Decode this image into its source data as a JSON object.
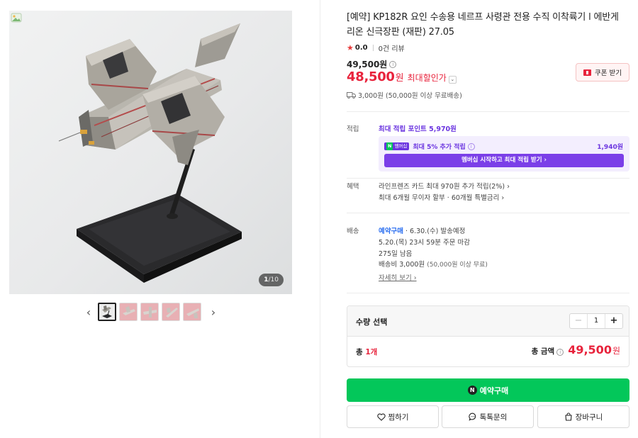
{
  "gallery": {
    "counter_current": "1",
    "counter_total": "/10",
    "prev_arrow": "‹",
    "next_arrow": "›",
    "thumbnail_count": 5,
    "icons": {
      "prev": "chevron-left-icon",
      "next": "chevron-right-icon",
      "badge": "image-badge-icon"
    }
  },
  "product": {
    "title": "[예약] KP182R 요인 수송용 네르프 사령관 전용 수직 이착륙기 l 에반게리온 신극장판 (재판) 27.05",
    "rating": "0.0",
    "review_count": "0건 리뷰",
    "original_price": "49,500원",
    "sale_price": "48,500",
    "sale_unit": "원",
    "sale_label": "최대할인가",
    "coupon_label": "쿠폰 받기",
    "shipping_summary": "3,000원 (50,000원 이상 무료배송)"
  },
  "points": {
    "label": "적립",
    "max_text": "최대 적립 포인트",
    "max_value": "5,970원",
    "member_badge": "멤버십",
    "member_extra": "최대 5% 추가 적립",
    "member_amount": "1,940원",
    "member_button": "멤버십 시작하고 최대 적립 받기 ›"
  },
  "benefits": {
    "label": "혜택",
    "line1": "라인프렌즈 카드 최대 970원 추가 적립(2%) ›",
    "line2": "최대 6개월 무이자 할부 · 60개월 특별금리 ›"
  },
  "delivery": {
    "label": "배송",
    "preorder": "예약구매",
    "ship_date": " · 6.30.(수) 발송예정",
    "deadline": "5.20.(목) 23시 59분 주문 마감",
    "days_left": "275일 남음",
    "fee": "배송비 3,000원",
    "fee_note": "(50,000원 이상 무료)",
    "detail_link": "자세히 보기 ›"
  },
  "quantity": {
    "label": "수량 선택",
    "value": "1",
    "minus": "−",
    "plus": "+",
    "total_prefix": "총 ",
    "total_count": "1개",
    "total_label": "총 금액",
    "total_price": "49,500",
    "total_unit": "원"
  },
  "actions": {
    "buy_icon_letter": "N",
    "buy_label": "예약구매",
    "wishlist_label": "찜하기",
    "talk_label": "톡톡문의",
    "cart_label": "장바구니"
  },
  "colors": {
    "sale_red": "#e8233c",
    "naver_green": "#03c75a",
    "membership_purple": "#6b35e0",
    "preorder_blue": "#2a6ef0"
  }
}
